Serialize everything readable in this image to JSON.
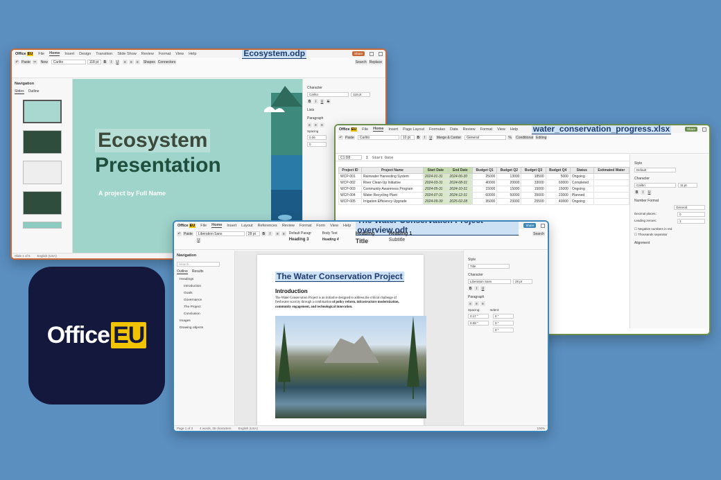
{
  "brand": {
    "name": "Office",
    "suffix": "EU"
  },
  "impress": {
    "doc_title": "Ecosystem.odp",
    "menu": [
      "File",
      "Home",
      "Insert",
      "Design",
      "Transition",
      "Slide Show",
      "Review",
      "Format",
      "View",
      "Help"
    ],
    "share": "Share",
    "font": "Carlito",
    "size": "118 pt",
    "nav": {
      "title": "Navigation",
      "tabs": [
        "Slides",
        "Outline"
      ]
    },
    "slide": {
      "title1": "Ecosystem",
      "title2": "Presentation",
      "subtitle": "A project by Full Name"
    },
    "right": {
      "character": "Character",
      "font": "Carlito",
      "size": "118 pt",
      "lists": "Lists",
      "paragraph": "Paragraph",
      "spacing": "Spacing",
      "sp1": "0.06",
      "sp2": "0"
    },
    "status": {
      "slide": "Slide 1 of 5",
      "lang": "English (USA)"
    },
    "ribbon": {
      "paste": "Paste",
      "new": "New",
      "shapes": "Shapes",
      "connectors": "Connectors",
      "search": "Search",
      "replace": "Replace"
    }
  },
  "calc": {
    "doc_title": "water_conservation_progress.xlsx",
    "menu": [
      "File",
      "Home",
      "Insert",
      "Page Layout",
      "Formulas",
      "Data",
      "Review",
      "Format",
      "View",
      "Help"
    ],
    "share": "Share",
    "font": "Carlito",
    "size": "10 pt",
    "cell_ref": "C1:D8",
    "formula": "Start Date",
    "format": "General",
    "ribbon": {
      "paste": "Paste",
      "merge": "Merge & Center",
      "conditional": "Conditional",
      "editing": "Editing"
    },
    "headers": [
      "Project ID",
      "Project Name",
      "Start Date",
      "End Date",
      "Budget Q1",
      "Budget Q2",
      "Budget Q3",
      "Budget Q4",
      "Status",
      "Estimated Water"
    ],
    "rows": [
      [
        "WCP-001",
        "Rainwater Harvesting System",
        "2024-01-31",
        "2024-06-30",
        "25000",
        "13000",
        "18500",
        "5000",
        "Ongoing",
        ""
      ],
      [
        "WCP-002",
        "River Clean-Up Initiative",
        "2024-03-31",
        "2024-08-31",
        "40000",
        "20000",
        "33000",
        "60000",
        "Completed",
        ""
      ],
      [
        "WCP-003",
        "Community Awareness Program",
        "2024-05-31",
        "2024-10-31",
        "15000",
        "15000",
        "15000",
        "15000",
        "Ongoing",
        ""
      ],
      [
        "WCP-004",
        "Water Recycling Plant",
        "2024-07-31",
        "2024-12-31",
        "60000",
        "50000",
        "35000",
        "23000",
        "Planned",
        ""
      ],
      [
        "WCP-005",
        "Irrigation Efficiency Upgrade",
        "2024-09-30",
        "2025-02-28",
        "35000",
        "23000",
        "25500",
        "40000",
        "Ongoing",
        ""
      ]
    ],
    "right": {
      "style": "Style",
      "default": "Default",
      "character": "Character",
      "font": "Calibri",
      "size": "11 pt",
      "number_format": "Number Format",
      "general": "General",
      "decimal": "Decimal places:",
      "decimal_val": "0",
      "leading": "Leading zeroes:",
      "leading_val": "1",
      "negative": "Negative numbers in red",
      "thousands": "Thousands separator",
      "alignment": "Alignment"
    }
  },
  "writer": {
    "doc_title": "The Water Conservation Project overview.odt",
    "menu": [
      "File",
      "Home",
      "Insert",
      "Layout",
      "References",
      "Review",
      "Format",
      "Form",
      "View",
      "Help"
    ],
    "share": "Share",
    "font": "Liberation Sans",
    "size": "28 pt",
    "styles": [
      "Default Paragr",
      "Body Text",
      "Heading",
      "Heading 1",
      "Heading 3",
      "Heading 4",
      "Title",
      "Subtitle"
    ],
    "ribbon": {
      "paste": "Paste",
      "search": "Search"
    },
    "nav": {
      "title": "Navigation",
      "search_placeholder": "Search...",
      "tabs": [
        "Outline",
        "Results"
      ],
      "headings": "Headings",
      "items": [
        "Introduction",
        "Goals",
        "Governance",
        "The Project",
        "Conclusion"
      ],
      "images": "Images",
      "drawing": "Drawing objects"
    },
    "page": {
      "title": "The Water Conservation Project",
      "h2": "Introduction",
      "p_plain": "The Water Conservation Project is an initiative designed to address the critical challenge of freshwater scarcity through a combination ",
      "p_bold": "of policy reform, infrastructure modernization, community engagement, and technological innovation."
    },
    "right": {
      "style": "Style",
      "title": "Title",
      "character": "Character",
      "font": "Liberation Sans",
      "size": "28 pt",
      "paragraph": "Paragraph",
      "spacing": "Spacing:",
      "indent": "Indent:",
      "sp1": "0.17 \"",
      "sp2": "0.08 \"",
      "in1": "0 \"",
      "in2": "0 \"",
      "in3": "0 \""
    },
    "status": {
      "page": "Page 1 of 3",
      "words": "4 words, 30 characters",
      "lang": "English (USA)",
      "zoom": "100%"
    }
  },
  "colors": {
    "impress_accent": "#c8693a",
    "calc_accent": "#6b8e4e",
    "writer_accent": "#3b86b8",
    "brand_yellow": "#f2c400",
    "background": "#5b8fc0"
  }
}
